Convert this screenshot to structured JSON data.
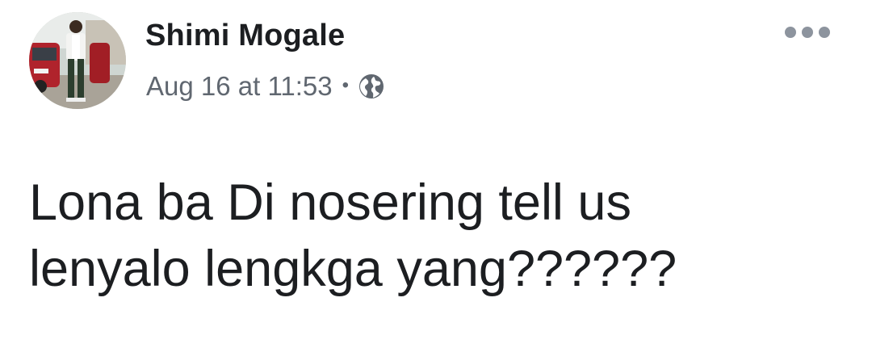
{
  "post": {
    "author": "Shimi Mogale",
    "timestamp": "Aug 16 at 11:53",
    "separator": "•",
    "privacy_icon": "globe-icon",
    "more_icon": "more-options-icon",
    "message_lines": [
      "Lona ba Di nosering tell us",
      "lenyalo lengkga yang??????"
    ]
  },
  "colors": {
    "author_text": "#1c1e21",
    "meta_text": "#606770",
    "icon_gray": "#8d949e",
    "background": "#ffffff"
  }
}
